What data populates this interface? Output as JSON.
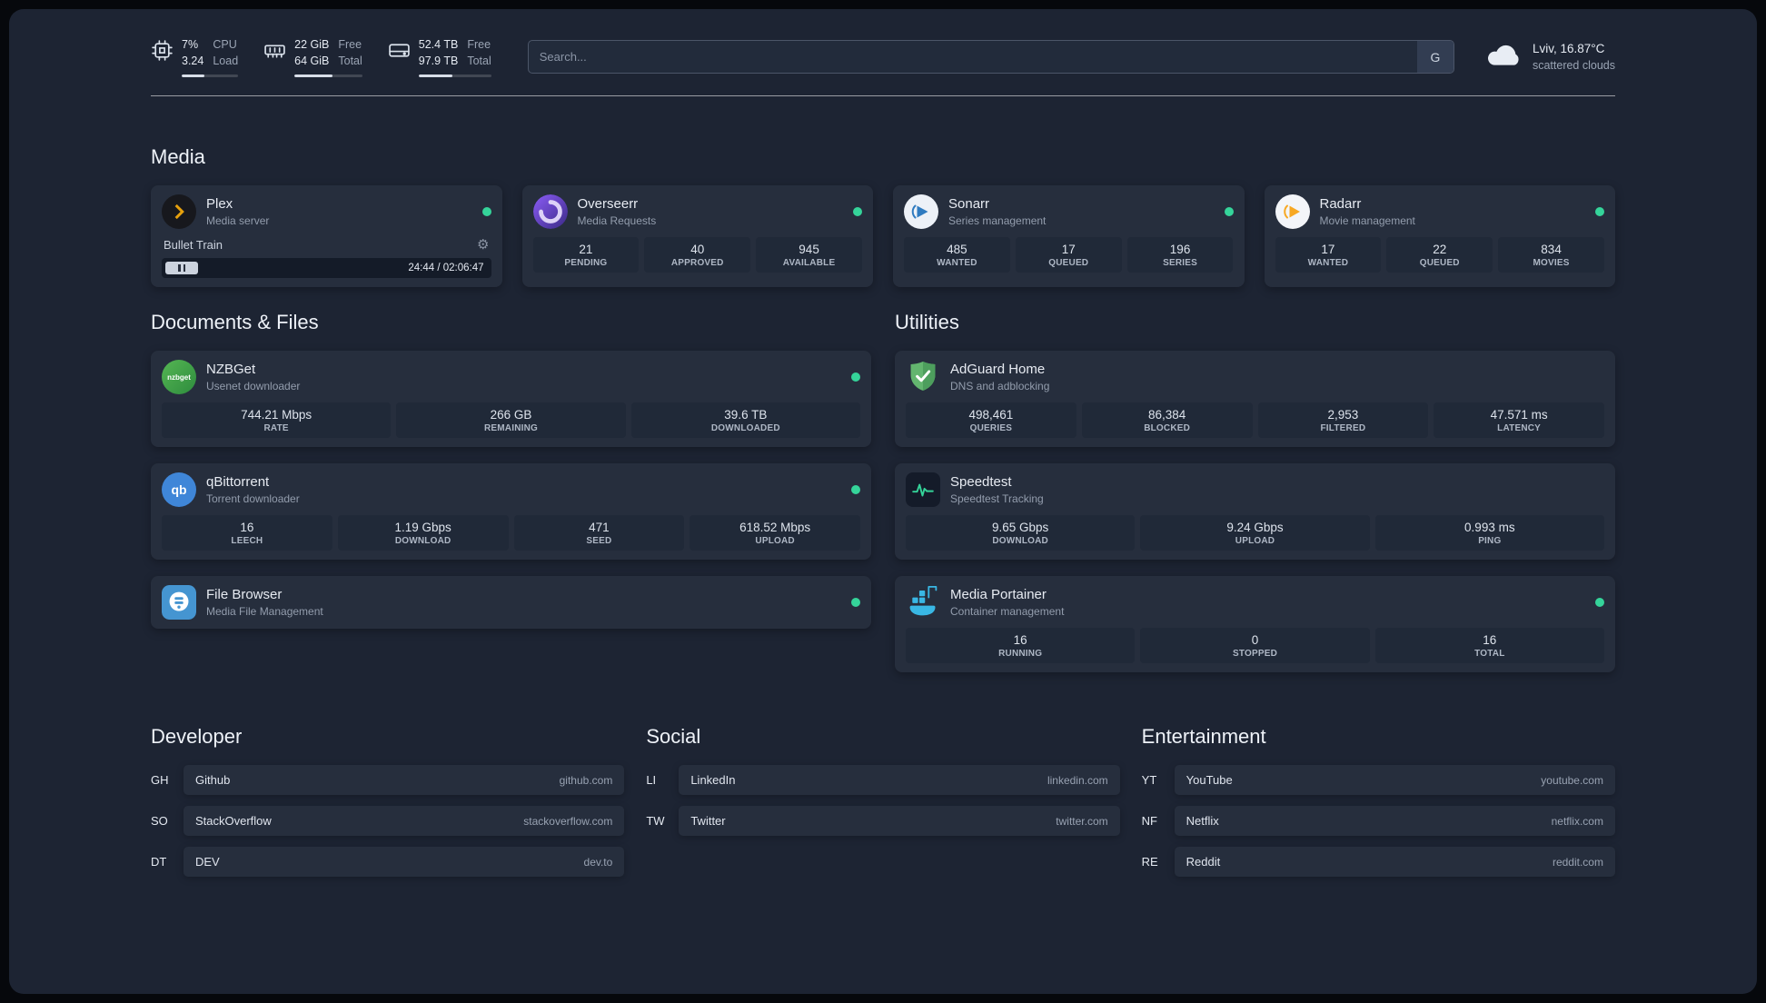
{
  "topbar": {
    "cpu": {
      "percent": "7%",
      "value": "3.24",
      "label_top": "CPU",
      "label_bottom": "Load"
    },
    "ram": {
      "free": "22 GiB",
      "total": "64 GiB",
      "label_top": "Free",
      "label_bottom": "Total"
    },
    "disk": {
      "free": "52.4 TB",
      "total": "97.9 TB",
      "label_top": "Free",
      "label_bottom": "Total"
    },
    "search": {
      "placeholder": "Search...",
      "button": "G"
    },
    "weather": {
      "location": "Lviv, 16.87°C",
      "condition": "scattered clouds"
    }
  },
  "media": {
    "title": "Media",
    "plex": {
      "name": "Plex",
      "desc": "Media server",
      "now_playing": "Bullet Train",
      "time": "24:44 / 02:06:47"
    },
    "overseerr": {
      "name": "Overseerr",
      "desc": "Media Requests",
      "stats": [
        {
          "value": "21",
          "label": "PENDING"
        },
        {
          "value": "40",
          "label": "APPROVED"
        },
        {
          "value": "945",
          "label": "AVAILABLE"
        }
      ]
    },
    "sonarr": {
      "name": "Sonarr",
      "desc": "Series management",
      "stats": [
        {
          "value": "485",
          "label": "WANTED"
        },
        {
          "value": "17",
          "label": "QUEUED"
        },
        {
          "value": "196",
          "label": "SERIES"
        }
      ]
    },
    "radarr": {
      "name": "Radarr",
      "desc": "Movie management",
      "stats": [
        {
          "value": "17",
          "label": "WANTED"
        },
        {
          "value": "22",
          "label": "QUEUED"
        },
        {
          "value": "834",
          "label": "MOVIES"
        }
      ]
    }
  },
  "documents": {
    "title": "Documents & Files",
    "nzbget": {
      "name": "NZBGet",
      "desc": "Usenet downloader",
      "icon_text": "nzbget",
      "stats": [
        {
          "value": "744.21 Mbps",
          "label": "RATE"
        },
        {
          "value": "266 GB",
          "label": "REMAINING"
        },
        {
          "value": "39.6 TB",
          "label": "DOWNLOADED"
        }
      ]
    },
    "qbittorrent": {
      "name": "qBittorrent",
      "desc": "Torrent downloader",
      "icon_text": "qb",
      "stats": [
        {
          "value": "16",
          "label": "LEECH"
        },
        {
          "value": "1.19 Gbps",
          "label": "DOWNLOAD"
        },
        {
          "value": "471",
          "label": "SEED"
        },
        {
          "value": "618.52 Mbps",
          "label": "UPLOAD"
        }
      ]
    },
    "filebrowser": {
      "name": "File Browser",
      "desc": "Media File Management"
    }
  },
  "utilities": {
    "title": "Utilities",
    "adguard": {
      "name": "AdGuard Home",
      "desc": "DNS and adblocking",
      "stats": [
        {
          "value": "498,461",
          "label": "QUERIES"
        },
        {
          "value": "86,384",
          "label": "BLOCKED"
        },
        {
          "value": "2,953",
          "label": "FILTERED"
        },
        {
          "value": "47.571 ms",
          "label": "LATENCY"
        }
      ]
    },
    "speedtest": {
      "name": "Speedtest",
      "desc": "Speedtest Tracking",
      "stats": [
        {
          "value": "9.65 Gbps",
          "label": "DOWNLOAD"
        },
        {
          "value": "9.24 Gbps",
          "label": "UPLOAD"
        },
        {
          "value": "0.993 ms",
          "label": "PING"
        }
      ]
    },
    "portainer": {
      "name": "Media Portainer",
      "desc": "Container management",
      "stats": [
        {
          "value": "16",
          "label": "RUNNING"
        },
        {
          "value": "0",
          "label": "STOPPED"
        },
        {
          "value": "16",
          "label": "TOTAL"
        }
      ]
    }
  },
  "bookmarks": {
    "developer": {
      "title": "Developer",
      "items": [
        {
          "abbr": "GH",
          "name": "Github",
          "url": "github.com"
        },
        {
          "abbr": "SO",
          "name": "StackOverflow",
          "url": "stackoverflow.com"
        },
        {
          "abbr": "DT",
          "name": "DEV",
          "url": "dev.to"
        }
      ]
    },
    "social": {
      "title": "Social",
      "items": [
        {
          "abbr": "LI",
          "name": "LinkedIn",
          "url": "linkedin.com"
        },
        {
          "abbr": "TW",
          "name": "Twitter",
          "url": "twitter.com"
        }
      ]
    },
    "entertainment": {
      "title": "Entertainment",
      "items": [
        {
          "abbr": "YT",
          "name": "YouTube",
          "url": "youtube.com"
        },
        {
          "abbr": "NF",
          "name": "Netflix",
          "url": "netflix.com"
        },
        {
          "abbr": "RE",
          "name": "Reddit",
          "url": "reddit.com"
        }
      ]
    }
  }
}
